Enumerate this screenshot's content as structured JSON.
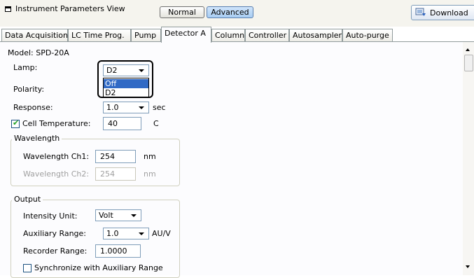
{
  "header": {
    "title": "Instrument Parameters View",
    "mode_normal": "Normal",
    "mode_advanced": "Advanced",
    "download": "Download"
  },
  "tabs": [
    {
      "label": "Data Acquisition"
    },
    {
      "label": "LC Time Prog."
    },
    {
      "label": "Pump"
    },
    {
      "label": "Detector A"
    },
    {
      "label": "Column"
    },
    {
      "label": "Controller"
    },
    {
      "label": "Autosampler"
    },
    {
      "label": "Auto-purge"
    }
  ],
  "detector": {
    "model": "Model: SPD-20A",
    "lamp_label": "Lamp:",
    "lamp_value": "D2",
    "lamp_options": [
      "Off",
      "D2"
    ],
    "polarity_label": "Polarity:",
    "response_label": "Response:",
    "response_value": "1.0",
    "response_unit": "sec",
    "cell_temp_label": "Cell Temperature:",
    "cell_temp_checked": true,
    "cell_temp_value": "40",
    "cell_temp_unit": "C"
  },
  "wavelength": {
    "group_label": "Wavelength",
    "ch1_label": "Wavelength Ch1:",
    "ch1_value": "254",
    "ch1_unit": "nm",
    "ch2_label": "Wavelength Ch2:",
    "ch2_value": "254",
    "ch2_unit": "nm"
  },
  "output": {
    "group_label": "Output",
    "intensity_label": "Intensity Unit:",
    "intensity_value": "Volt",
    "aux_label": "Auxiliary Range:",
    "aux_value": "1.0",
    "aux_unit": "AU/V",
    "recorder_label": "Recorder Range:",
    "recorder_value": "1.0000",
    "sync_label": "Synchronize with Auxiliary Range",
    "sync_checked": false
  },
  "colors": {
    "selection": "#316ac5",
    "advanced_button": "#a8cdf2",
    "checkmark": "#21a121"
  }
}
